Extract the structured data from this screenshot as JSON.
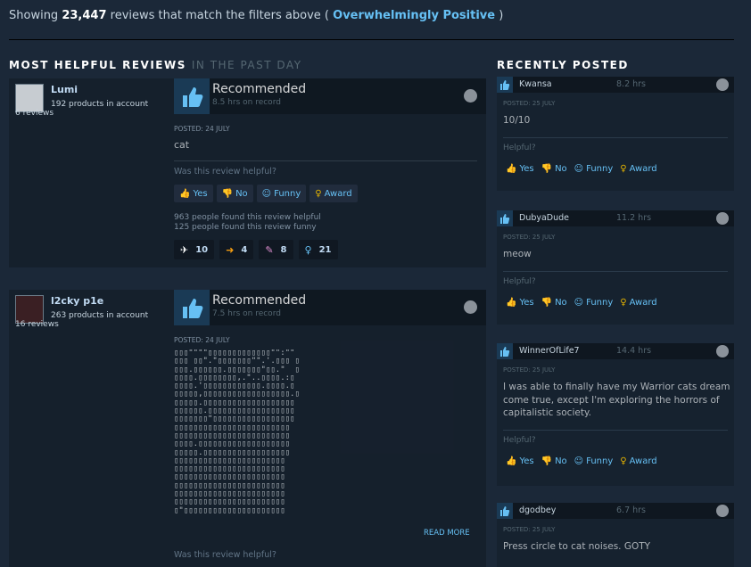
{
  "summary": {
    "prefix": "Showing",
    "count": "23,447",
    "middle": "reviews that match the filters above (",
    "rating": "Overwhelmingly Positive",
    "suffix": ")"
  },
  "left_section": {
    "title": "MOST HELPFUL REVIEWS",
    "sub": "IN THE PAST DAY"
  },
  "right_section": {
    "title": "RECENTLY POSTED"
  },
  "buttons": {
    "yes": "Yes",
    "no": "No",
    "funny": "Funny",
    "award": "Award"
  },
  "helpful_question": "Was this review helpful?",
  "helpful_short": "Helpful?",
  "reviews": [
    {
      "name": "Lumi",
      "products": "192 products in account",
      "reviews": "6 reviews",
      "verdict": "Recommended",
      "hours": "8.5 hrs on record",
      "posted": "POSTED: 24 JULY",
      "text": "cat",
      "found_helpful": "963 people found this review helpful",
      "found_funny": "125 people found this review funny",
      "awards": [
        "10",
        "4",
        "8",
        "21"
      ]
    },
    {
      "name": "l2cky p1e",
      "products": "263 products in account",
      "reviews": "16 reviews",
      "verdict": "Recommended",
      "hours": "7.5 hrs on record",
      "posted": "POSTED: 24 JULY",
      "read_more": "READ MORE"
    }
  ],
  "recent": [
    {
      "name": "Kwansa",
      "hours": "8.2 hrs",
      "posted": "POSTED: 25 JULY",
      "text": "10/10"
    },
    {
      "name": "DubyaDude",
      "hours": "11.2 hrs",
      "posted": "POSTED: 25 JULY",
      "text": "meow"
    },
    {
      "name": "WinnerOfLife7",
      "hours": "14.4 hrs",
      "posted": "POSTED: 25 JULY",
      "text": "I was able to finally have my Warrior cats dream come true, except I'm exploring the horrors of capitalistic society."
    },
    {
      "name": "dgodbey",
      "hours": "6.7 hrs",
      "posted": "POSTED: 25 JULY",
      "text": "Press circle to cat noises. GOTY"
    }
  ],
  "colors": {
    "accent": "#66c0f4",
    "background": "#1b2838",
    "award": "#e5b400"
  }
}
